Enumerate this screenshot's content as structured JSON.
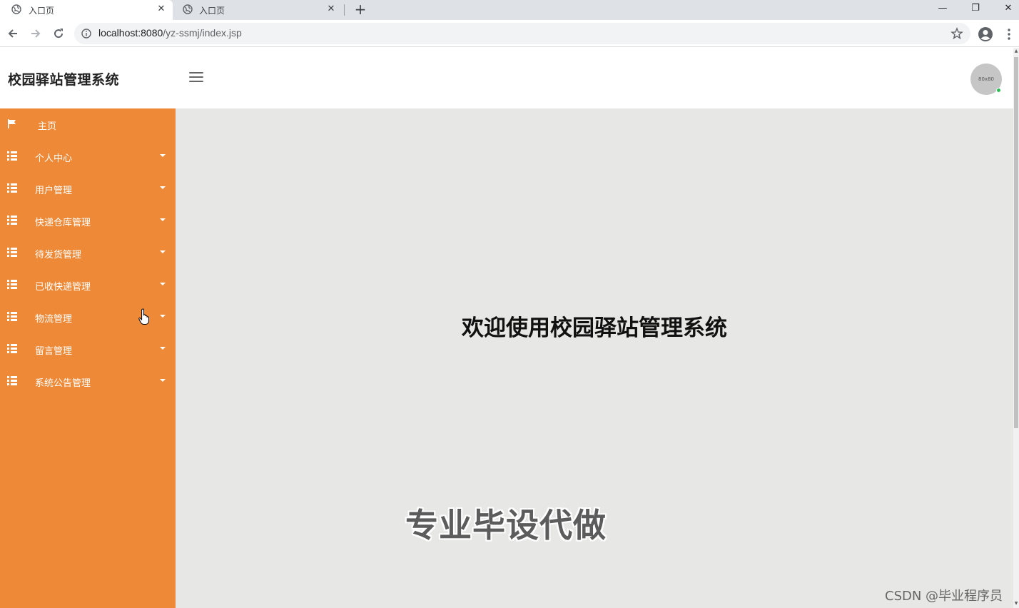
{
  "browser": {
    "tabs": [
      {
        "title": "入口页",
        "active": true
      },
      {
        "title": "入口页",
        "active": false
      }
    ],
    "new_tab_label": "+",
    "window_controls": {
      "minimize": "—",
      "restore": "❐",
      "close": "✕"
    },
    "address": {
      "host": "localhost:8080",
      "path": "/yz-ssmj/index.jsp"
    }
  },
  "header": {
    "brand": "校园驿站管理系统",
    "avatar_text": "80x80"
  },
  "sidebar": {
    "items": [
      {
        "label": "主页",
        "icon": "flag-icon",
        "has_submenu": false
      },
      {
        "label": "个人中心",
        "icon": "grid-icon",
        "has_submenu": true
      },
      {
        "label": "用户管理",
        "icon": "grid-icon",
        "has_submenu": true
      },
      {
        "label": "快递仓库管理",
        "icon": "grid-icon",
        "has_submenu": true
      },
      {
        "label": "待发货管理",
        "icon": "grid-icon",
        "has_submenu": true
      },
      {
        "label": "已收快递管理",
        "icon": "grid-icon",
        "has_submenu": true
      },
      {
        "label": "物流管理",
        "icon": "grid-icon",
        "has_submenu": true
      },
      {
        "label": "留言管理",
        "icon": "grid-icon",
        "has_submenu": true
      },
      {
        "label": "系统公告管理",
        "icon": "grid-icon",
        "has_submenu": true
      }
    ]
  },
  "main": {
    "welcome": "欢迎使用校园驿站管理系统"
  },
  "overlays": {
    "watermark": "专业毕设代做",
    "csdn": "CSDN @毕业程序员"
  },
  "colors": {
    "sidebar_bg": "#ee8a37",
    "main_bg": "#e7e7e6",
    "online": "#2bbf53"
  }
}
